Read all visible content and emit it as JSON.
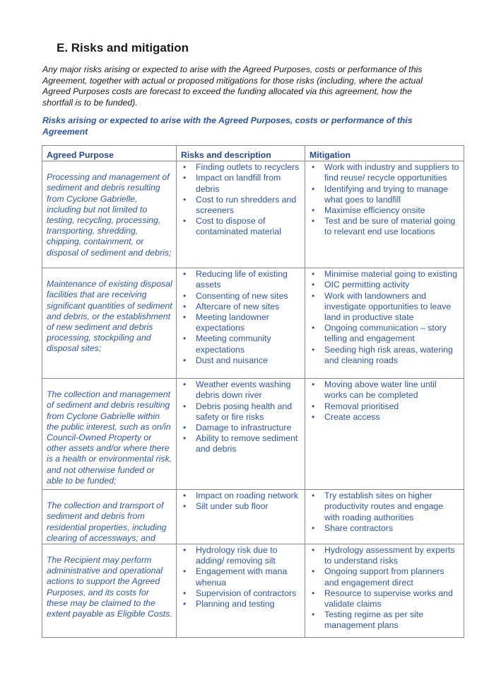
{
  "section": {
    "heading": "E. Risks and mitigation",
    "intro": "Any major risks arising or expected to arise with the Agreed Purposes, costs or performance of this Agreement, together with actual or proposed mitigations for those risks (including, where the actual Agreed Purposes costs are forecast to exceed the funding allocated via this agreement, how the shortfall is to be funded).",
    "subheading": "Risks arising or expected to arise with the Agreed Purposes, costs or performance of this Agreement"
  },
  "colors": {
    "heading_text": "#1a1a1a",
    "accent_blue": "#2e55a4",
    "table_border": "#8a8a8a"
  },
  "table": {
    "headers": [
      "Agreed Purpose",
      "Risks and description",
      "Mitigation"
    ],
    "rows": [
      {
        "purpose": "Processing and management of sediment and debris resulting from Cyclone Gabrielle, including but not limited to testing, recycling, processing, transporting, shredding, chipping, containment, or disposal of sediment and debris;",
        "risks": [
          "Finding outlets to recyclers",
          "Impact on landfill from debris",
          "Cost to run shredders and screeners",
          "Cost to dispose of contaminated material"
        ],
        "mitigation": [
          "Work with industry and suppliers to find reuse/ recycle opportunities",
          "Identifying and trying to manage what goes to landfill",
          "Maximise efficiency onsite",
          "Test and be sure of material going to relevant end use locations"
        ]
      },
      {
        "purpose": "Maintenance of existing disposal facilities that are receiving significant quantities of sediment and debris, or the establishment of new sediment and debris processing, stockpiling and disposal sites;",
        "risks": [
          "Reducing life of existing assets",
          "Consenting of new sites",
          "Aftercare of new sites",
          "Meeting landowner expectations",
          "Meeting community expectations",
          "Dust and nuisance"
        ],
        "mitigation": [
          "Minimise material going to existing",
          "OIC permitting activity",
          "Work with landowners and investigate opportunities to leave land in productive state",
          "Ongoing communication – story telling and engagement",
          "Seeding high risk areas, watering and cleaning roads"
        ]
      },
      {
        "purpose": "The collection and management of sediment and debris resulting from Cyclone Gabrielle within the public interest, such as on/in Council-Owned Property or other assets and/or where there is a health or environmental risk, and not otherwise funded or able to be funded;",
        "risks": [
          "Weather events washing debris down river",
          "Debris posing health and safety or fire risks",
          "Damage to infrastructure",
          "Ability to remove sediment and debris"
        ],
        "mitigation": [
          "Moving above water line until works can be completed",
          "Removal prioritised",
          "Create access"
        ]
      },
      {
        "purpose": "The collection and transport of sediment and debris from residential properties, including clearing of accessways; and",
        "risks": [
          "Impact on roading network",
          "Silt under sub floor"
        ],
        "mitigation": [
          "Try establish sites on higher productivity routes and engage with roading authorities",
          "Share contractors"
        ]
      },
      {
        "purpose": "The Recipient may perform administrative and operational actions to support the Agreed Purposes, and its costs for these may be claimed to the extent payable as Eligible Costs.",
        "risks": [
          "Hydrology risk due to adding/ removing silt",
          "Engagement with mana whenua",
          "Supervision of contractors",
          "Planning and testing"
        ],
        "mitigation": [
          "Hydrology assessment by experts to understand risks",
          "Ongoing support from planners and engagement direct",
          "Resource to supervise works and validate claims",
          "Testing regime as per site management plans"
        ]
      }
    ]
  }
}
